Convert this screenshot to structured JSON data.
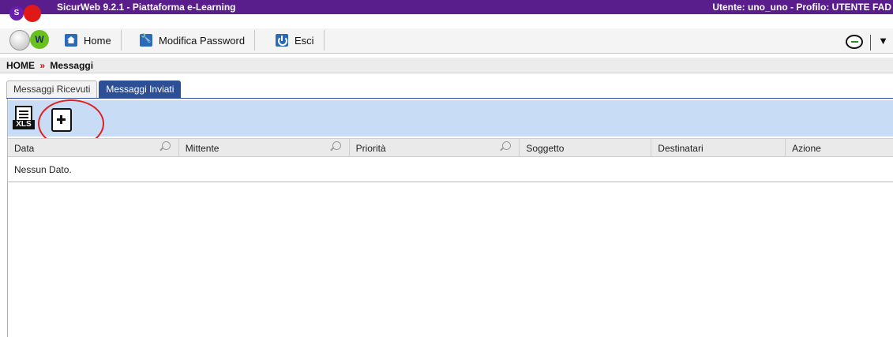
{
  "titlebar": {
    "app_title": "SicurWeb 9.2.1 - Piattaforma e-Learning",
    "user_info": "Utente: uno_uno - Profilo: UTENTE FAD"
  },
  "logo": {
    "s_letter": "S",
    "w_letter": "W"
  },
  "toolbar": {
    "home_label": "Home",
    "password_label": "Modifica Password",
    "exit_label": "Esci",
    "caret": "▼"
  },
  "breadcrumb": {
    "home": "HOME",
    "separator": "»",
    "current": "Messaggi"
  },
  "tabs": [
    {
      "label": "Messaggi Ricevuti",
      "active": false
    },
    {
      "label": "Messaggi Inviati",
      "active": true
    }
  ],
  "panel": {
    "xls_label": "XLS",
    "columns": [
      "Data",
      "Mittente",
      "Priorità",
      "Soggetto",
      "Destinatari",
      "Azione"
    ],
    "empty_text": "Nessun Dato."
  },
  "colors": {
    "titlebar": "#5a1e8c",
    "active_tab": "#2d4f96",
    "panel_toolbar": "#c9dcf5",
    "highlight": "#e02020"
  }
}
